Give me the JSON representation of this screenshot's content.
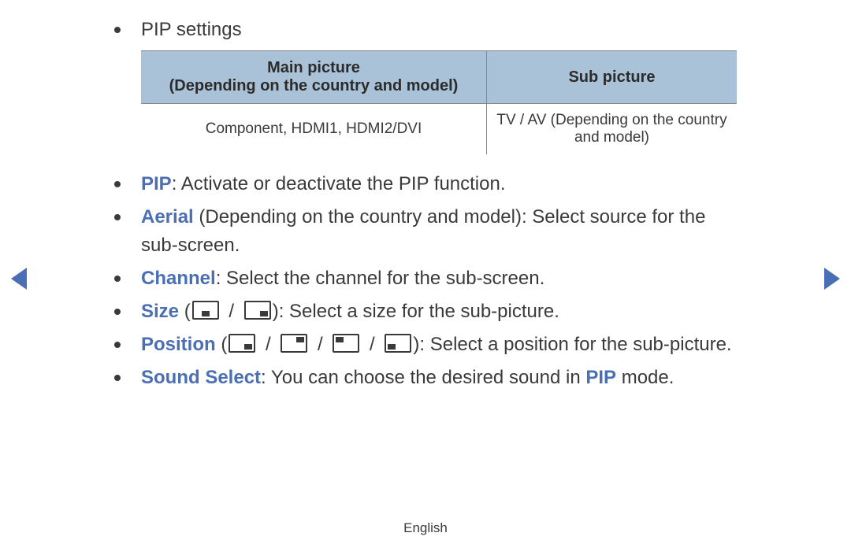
{
  "header": {
    "title": "PIP settings"
  },
  "table": {
    "col1_header_line1": "Main picture",
    "col1_header_line2": "(Depending on the country and model)",
    "col2_header": "Sub picture",
    "row": {
      "main": "Component, HDMI1, HDMI2/DVI",
      "sub": "TV / AV (Depending on the country and model)"
    }
  },
  "items": {
    "pip": {
      "term": "PIP",
      "text": ": Activate or deactivate the PIP function."
    },
    "aerial": {
      "term": "Aerial",
      "text": " (Depending on the country and model): Select source for the sub-screen."
    },
    "channel": {
      "term": "Channel",
      "text": ": Select the channel for the sub-screen."
    },
    "size": {
      "term": "Size",
      "pre": " (",
      "sep": " / ",
      "post": "): Select a size for the sub-picture."
    },
    "position": {
      "term": "Position",
      "pre": " (",
      "sep": " / ",
      "post": "): Select a position for the sub-picture."
    },
    "sound": {
      "term": "Sound Select",
      "text1": ": You can choose the desired sound in ",
      "pip_word": "PIP",
      "text2": " mode."
    }
  },
  "footer": {
    "language": "English"
  }
}
